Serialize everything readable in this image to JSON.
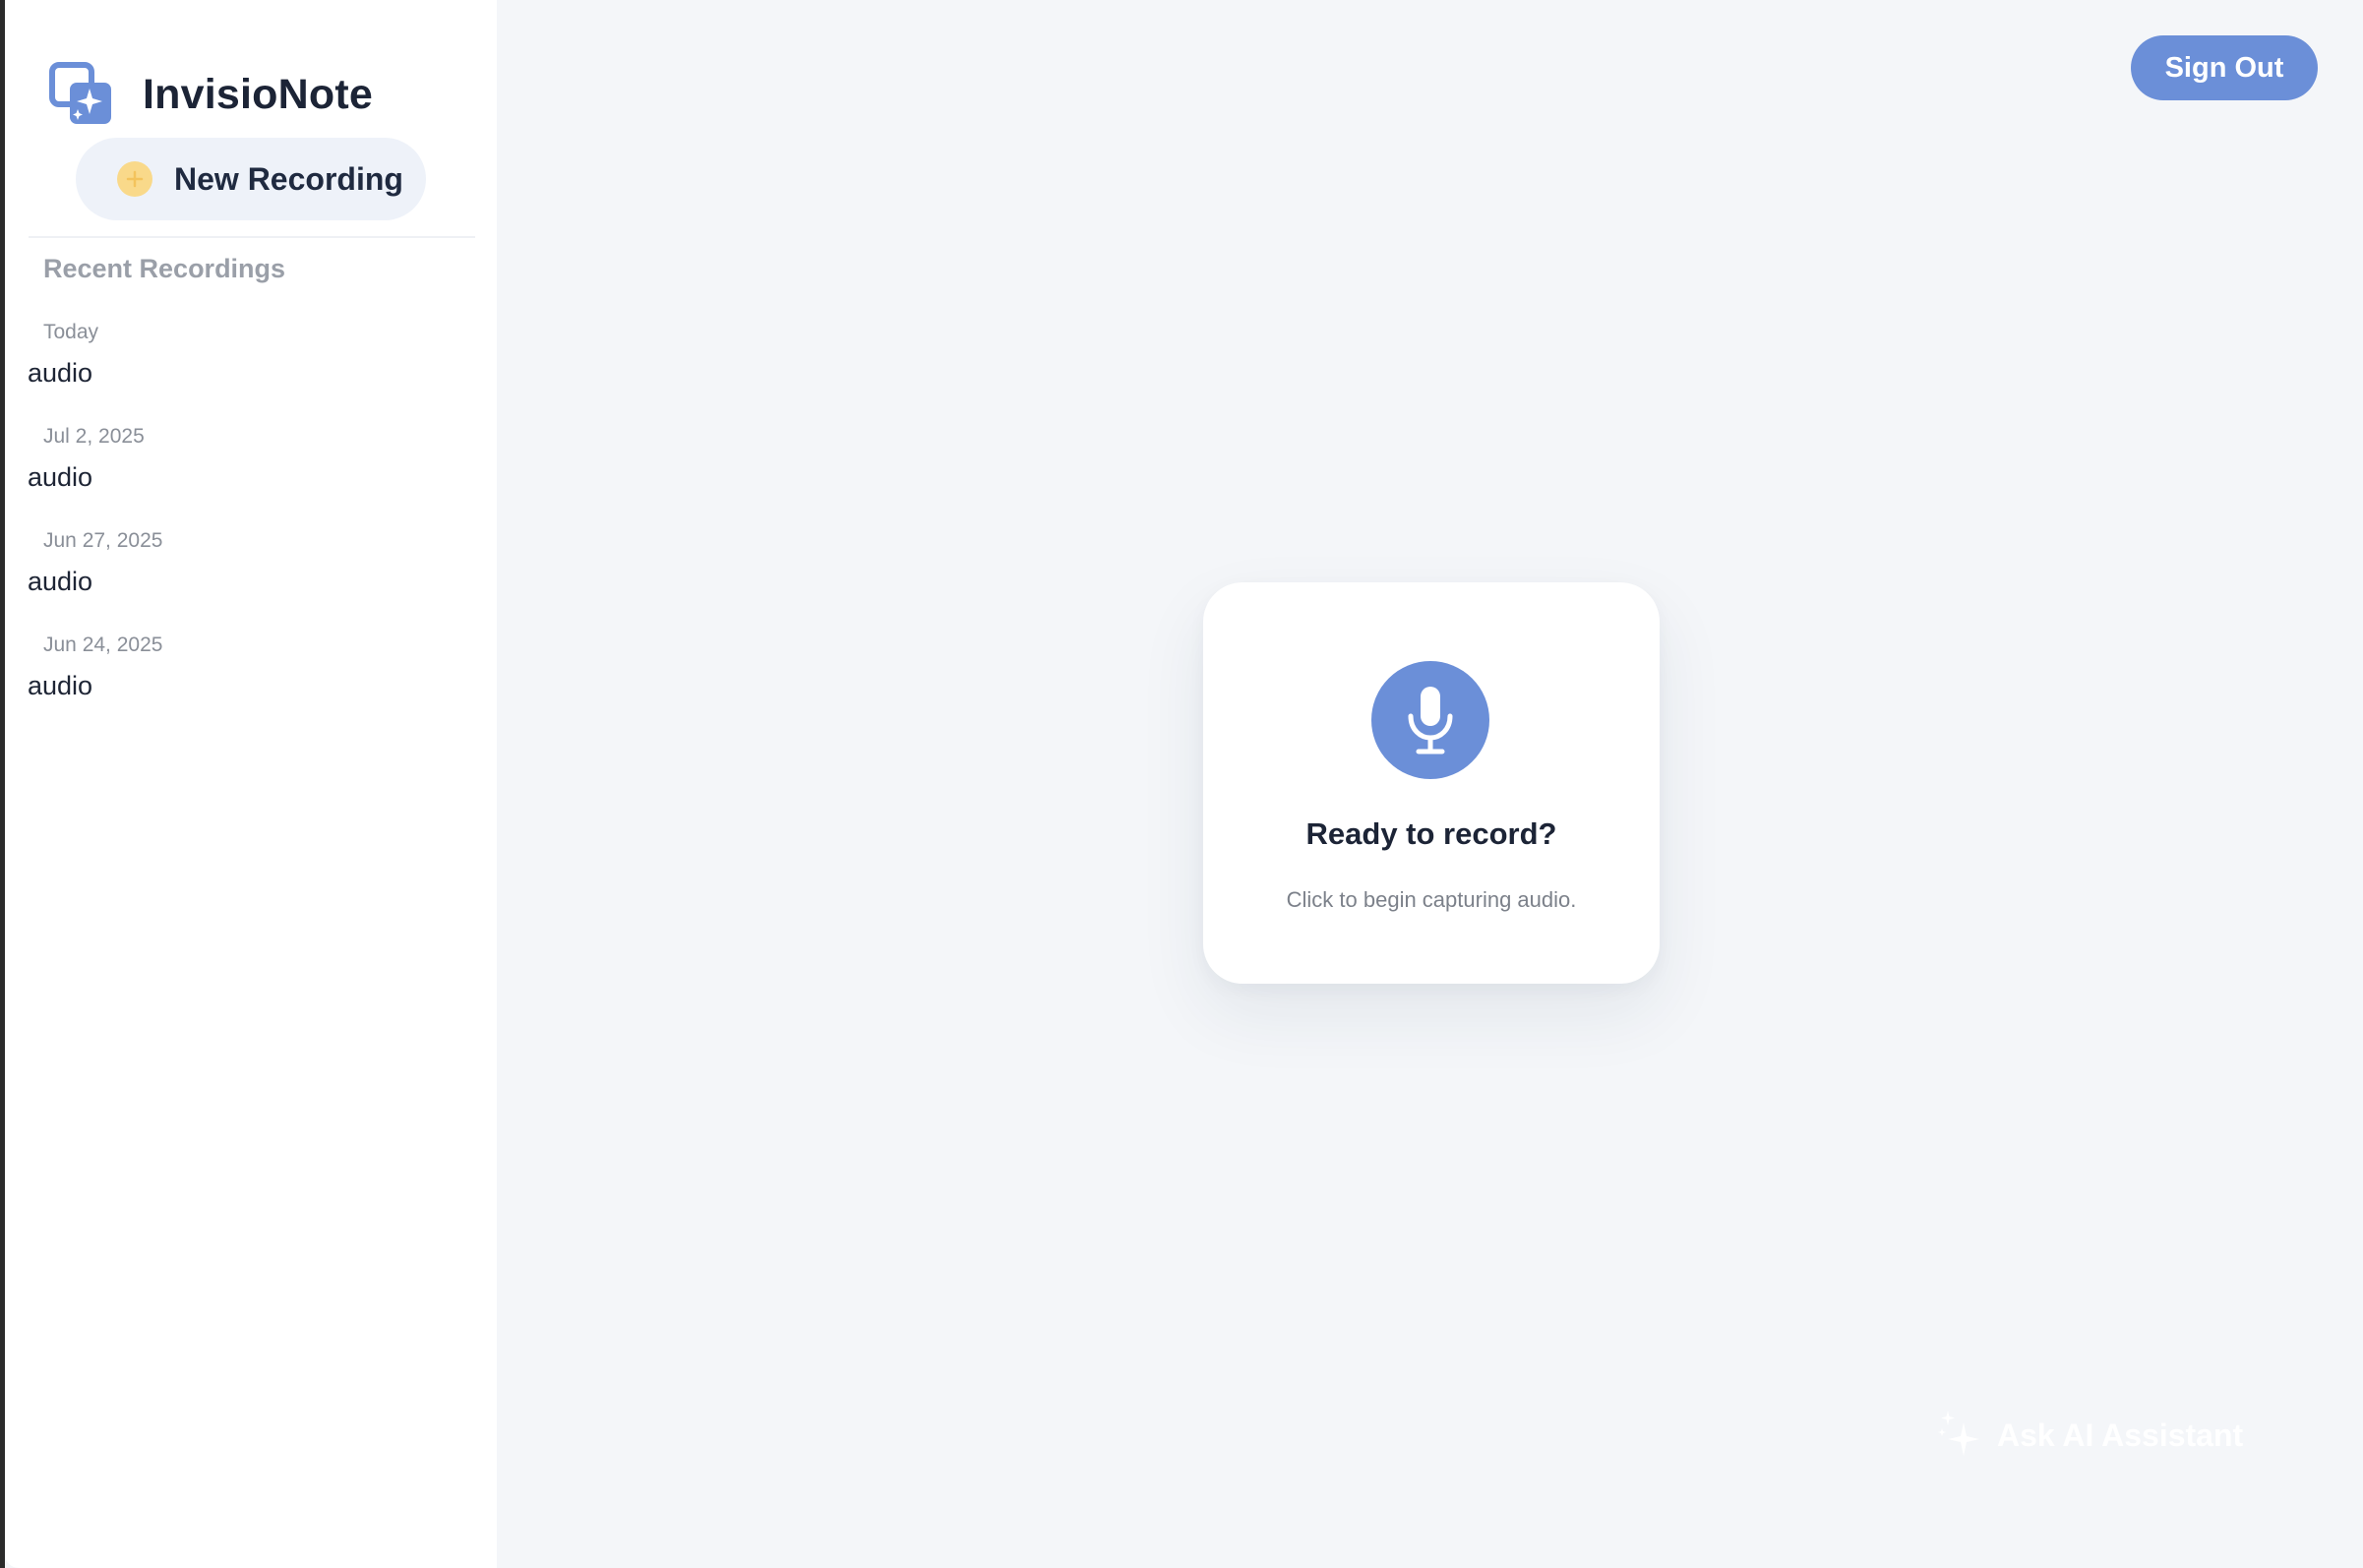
{
  "app": {
    "name": "InvisioNote"
  },
  "sidebar": {
    "new_recording_label": "New Recording",
    "recent_title": "Recent Recordings",
    "recordings": [
      {
        "date": "Today",
        "title": "audio"
      },
      {
        "date": "Jul 2, 2025",
        "title": "audio"
      },
      {
        "date": "Jun 27, 2025",
        "title": "audio"
      },
      {
        "date": "Jun 24, 2025",
        "title": "audio"
      }
    ]
  },
  "header": {
    "sign_out_label": "Sign Out"
  },
  "record_card": {
    "title": "Ready to record?",
    "subtitle": "Click to begin capturing audio."
  },
  "assistant": {
    "label": "Ask AI Assistant"
  },
  "colors": {
    "accent": "#6b8fd8",
    "plus_badge": "#f9d98a",
    "background": "#f4f6f9"
  },
  "icons": {
    "brand": "brand-logo-icon",
    "plus": "plus-icon",
    "mic": "microphone-icon",
    "sparkle": "sparkle-icon"
  }
}
